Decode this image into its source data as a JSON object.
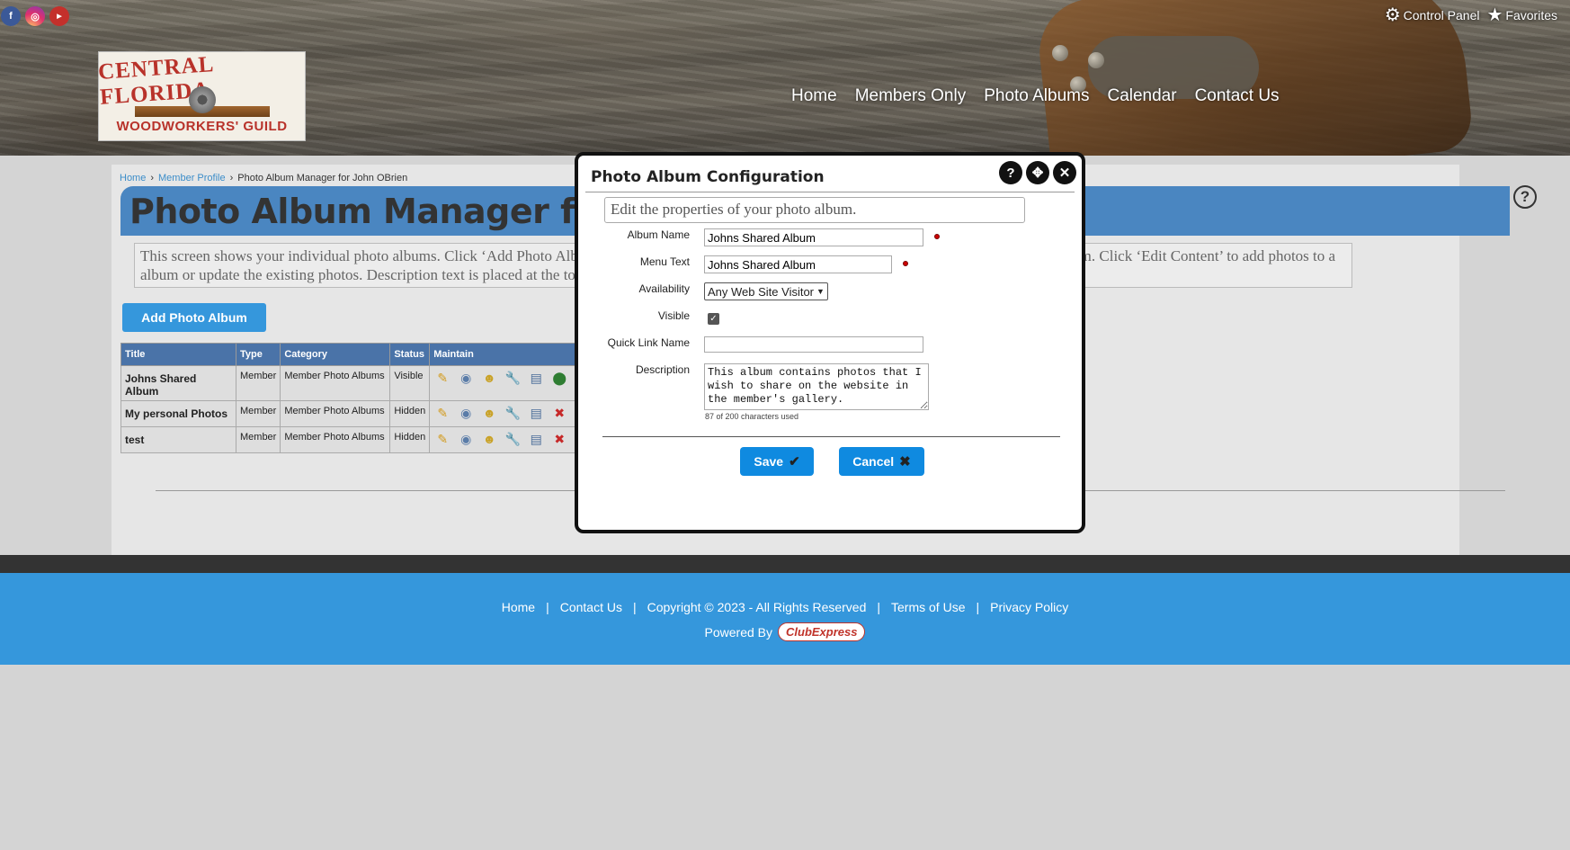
{
  "header": {
    "social": [
      {
        "name": "facebook",
        "glyph": "f"
      },
      {
        "name": "instagram",
        "glyph": "◎"
      },
      {
        "name": "youtube",
        "glyph": "You\nTube"
      }
    ],
    "control_panel": "Control Panel",
    "favorites": "Favorites",
    "logo": {
      "line1": "CENTRAL FLORIDA",
      "line2": "WOODWORKERS' GUILD"
    },
    "nav": [
      "Home",
      "Members Only",
      "Photo Albums",
      "Calendar",
      "Contact Us"
    ]
  },
  "breadcrumb": {
    "home": "Home",
    "profile": "Member Profile",
    "current": "Photo Album Manager for John OBrien"
  },
  "page_title": "Photo Album Manager for John OBrien",
  "info_text": "This screen shows your individual photo albums. Click ‘Add Photo Album’ to create a new album. Click ‘Configure’ to modify the properties of that album. Click ‘Edit Content’ to add photos to a album or update the existing photos. Description text is placed at the top of your album.",
  "add_button": "Add Photo Album",
  "table": {
    "headers": [
      "Title",
      "Type",
      "Category",
      "Status",
      "Maintain"
    ],
    "rows": [
      {
        "title": "Johns Shared Album",
        "type": "Member",
        "category": "Member Photo Albums",
        "status": "Visible"
      },
      {
        "title": "My personal Photos",
        "type": "Member",
        "category": "Member Photo Albums",
        "status": "Hidden"
      },
      {
        "title": "test",
        "type": "Member",
        "category": "Member Photo Albums",
        "status": "Hidden"
      }
    ]
  },
  "footer": {
    "links": [
      "Home",
      "|",
      "Contact Us",
      "|",
      "Copyright © 2023 - All Rights Reserved",
      "|",
      "Terms of Use",
      "|",
      "Privacy Policy"
    ],
    "powered_by": "Powered By",
    "brand": "ClubExpress"
  },
  "modal": {
    "title": "Photo Album Configuration",
    "intro": "Edit the properties of your photo album.",
    "album_name_label": "Album Name",
    "album_name_value": "Johns Shared Album",
    "menu_text_label": "Menu Text",
    "menu_text_value": "Johns Shared Album",
    "availability_label": "Availability",
    "availability_value": "Any Web Site Visitor",
    "visible_label": "Visible",
    "visible_checked": true,
    "quick_link_label": "Quick Link Name",
    "quick_link_value": "",
    "description_label": "Description",
    "description_value": "This album contains photos that I wish to share on the website in the member's gallery.",
    "char_count": "87 of 200 characters used",
    "save_label": "Save",
    "cancel_label": "Cancel"
  },
  "colors": {
    "accent": "#3597dc",
    "title_band": "#4a86c1",
    "table_header": "#4a73a8",
    "footer_dark": "#333333",
    "required": "#cc0000"
  }
}
